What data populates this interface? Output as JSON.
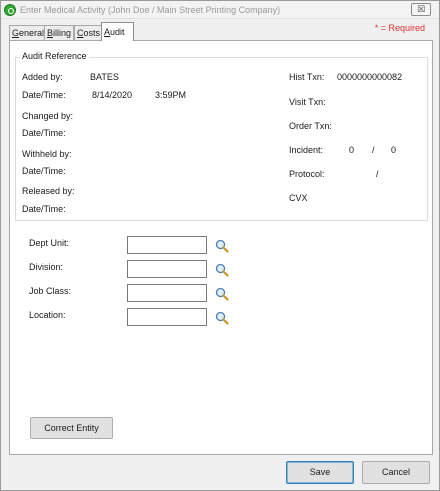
{
  "window": {
    "title": "Enter Medical Activity (John Doe / Main Street Printing Company)",
    "close_glyph": "☒"
  },
  "tabs": [
    {
      "label": "General",
      "underline": "G",
      "rest": "eneral",
      "active": false
    },
    {
      "label": "Billing",
      "underline": "B",
      "rest": "illing",
      "active": false
    },
    {
      "label": "Costs",
      "underline": "C",
      "rest": "osts",
      "active": false
    },
    {
      "label": "Audit",
      "underline": "A",
      "rest": "udit",
      "active": true
    }
  ],
  "required_note": "* = Required",
  "audit": {
    "group_title": "Audit Reference",
    "added_by_label": "Added by:",
    "added_by_value": "BATES",
    "datetime_label": "Date/Time:",
    "added_date": "8/14/2020",
    "added_time": "3:59PM",
    "changed_by_label": "Changed by:",
    "withheld_by_label": "Withheld by:",
    "released_by_label": "Released by:",
    "hist_txn_label": "Hist Txn:",
    "hist_txn_value": "0000000000082",
    "visit_txn_label": "Visit Txn:",
    "order_txn_label": "Order Txn:",
    "incident_label": "Incident:",
    "incident_value_1": "0",
    "incident_separator": "/",
    "incident_value_2": "0",
    "protocol_label": "Protocol:",
    "protocol_separator": "/",
    "cvx_label": "CVX"
  },
  "entity_fields": [
    {
      "label": "Dept Unit:",
      "value": ""
    },
    {
      "label": "Division:",
      "value": ""
    },
    {
      "label": "Job Class:",
      "value": ""
    },
    {
      "label": "Location:",
      "value": ""
    }
  ],
  "icons": {
    "lookup": "magnifier-icon",
    "app": "app-icon"
  },
  "buttons": {
    "correct_entity": "Correct Entity",
    "save": "Save",
    "cancel": "Cancel"
  },
  "colors": {
    "required": "#e03030",
    "default_button_border": "#3c7fb1"
  }
}
